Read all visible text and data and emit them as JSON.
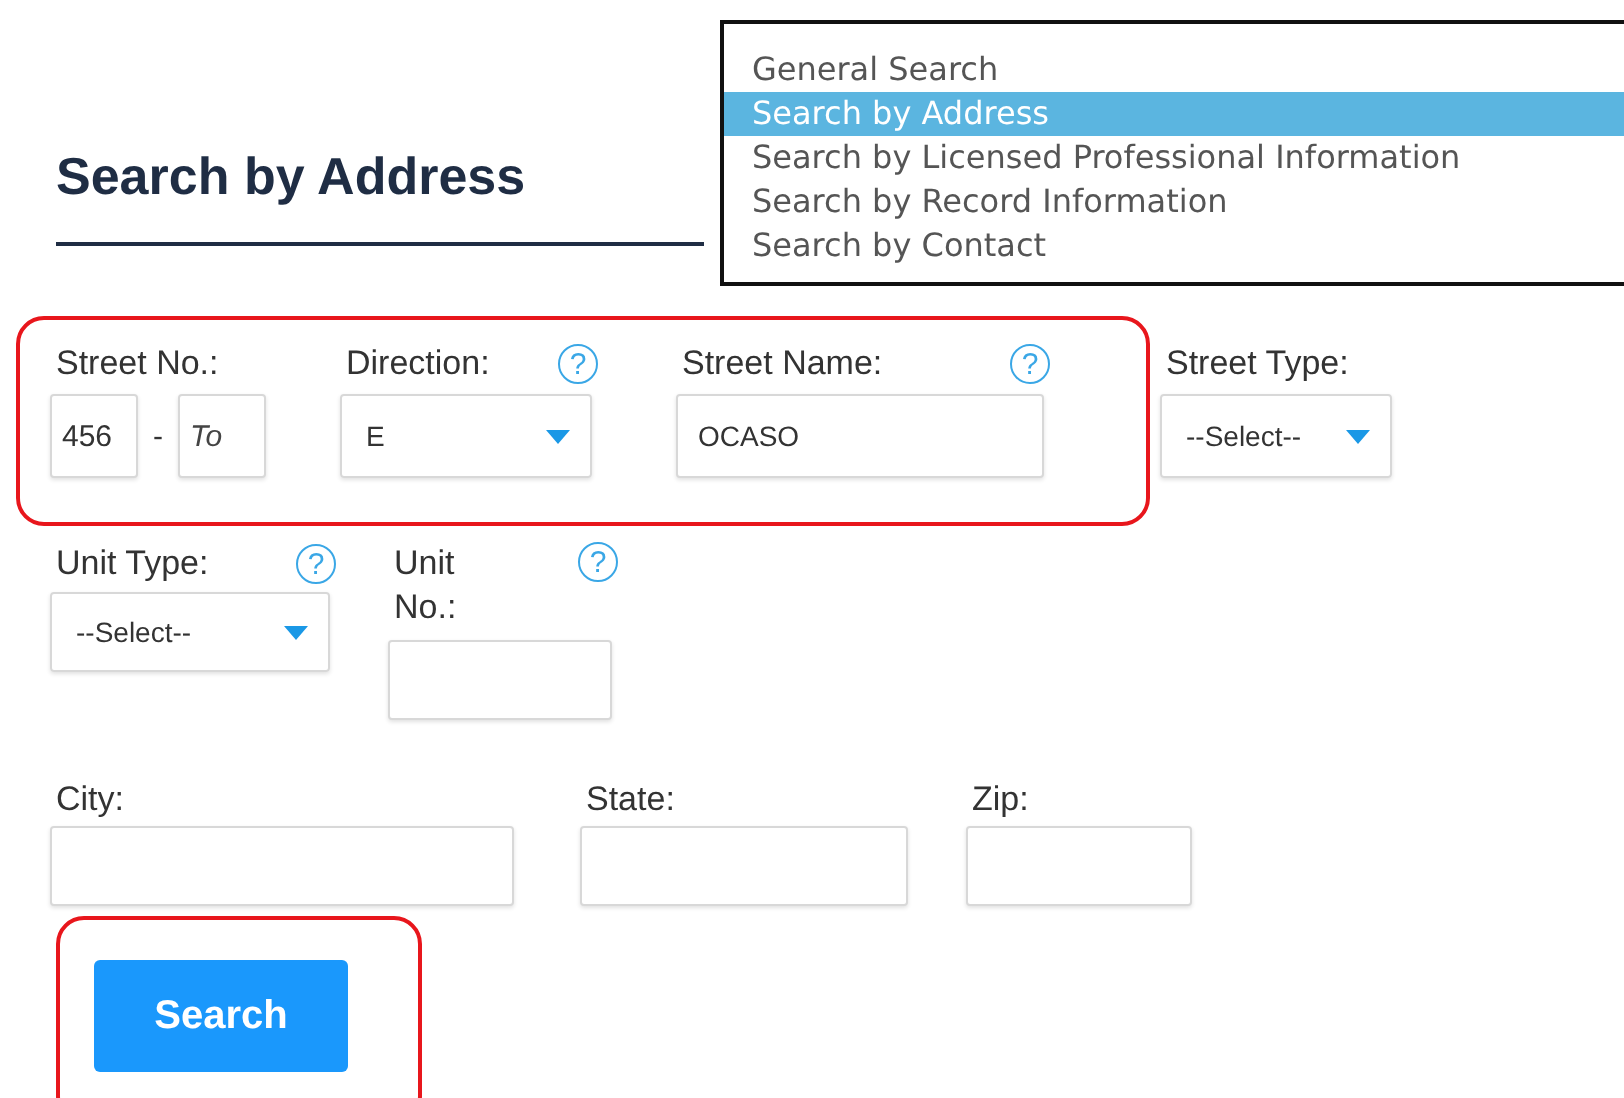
{
  "heading": "Search by Address",
  "rows": [
    [
      {
        "kind": "range",
        "label": "Street No.:",
        "value": "456",
        "separator": "-",
        "placeholder": "To"
      },
      {
        "kind": "select",
        "label": "Direction:",
        "help": "?",
        "value": "E"
      },
      {
        "kind": "text",
        "label": "Street Name:",
        "help": "?",
        "value": "OCASO"
      },
      {
        "kind": "select",
        "label": "Street Type:",
        "value": "--Select--"
      }
    ],
    [
      {
        "kind": "select",
        "label": "Unit Type:",
        "help": "?",
        "value": "--Select--"
      },
      {
        "kind": "text",
        "label": "Unit No.:",
        "help": "?"
      }
    ],
    [
      {
        "kind": "text",
        "label": "City:"
      },
      {
        "kind": "text",
        "label": "State:"
      },
      {
        "kind": "text",
        "label": "Zip:"
      }
    ]
  ],
  "button": "Search",
  "search_type_list": [
    {
      "label": "General Search",
      "selected": false
    },
    {
      "label": "Search by Address",
      "selected": true
    },
    {
      "label": "Search by Licensed Professional Information",
      "selected": false
    },
    {
      "label": "Search by Record Information",
      "selected": false
    },
    {
      "label": "Search by Contact",
      "selected": false
    }
  ]
}
